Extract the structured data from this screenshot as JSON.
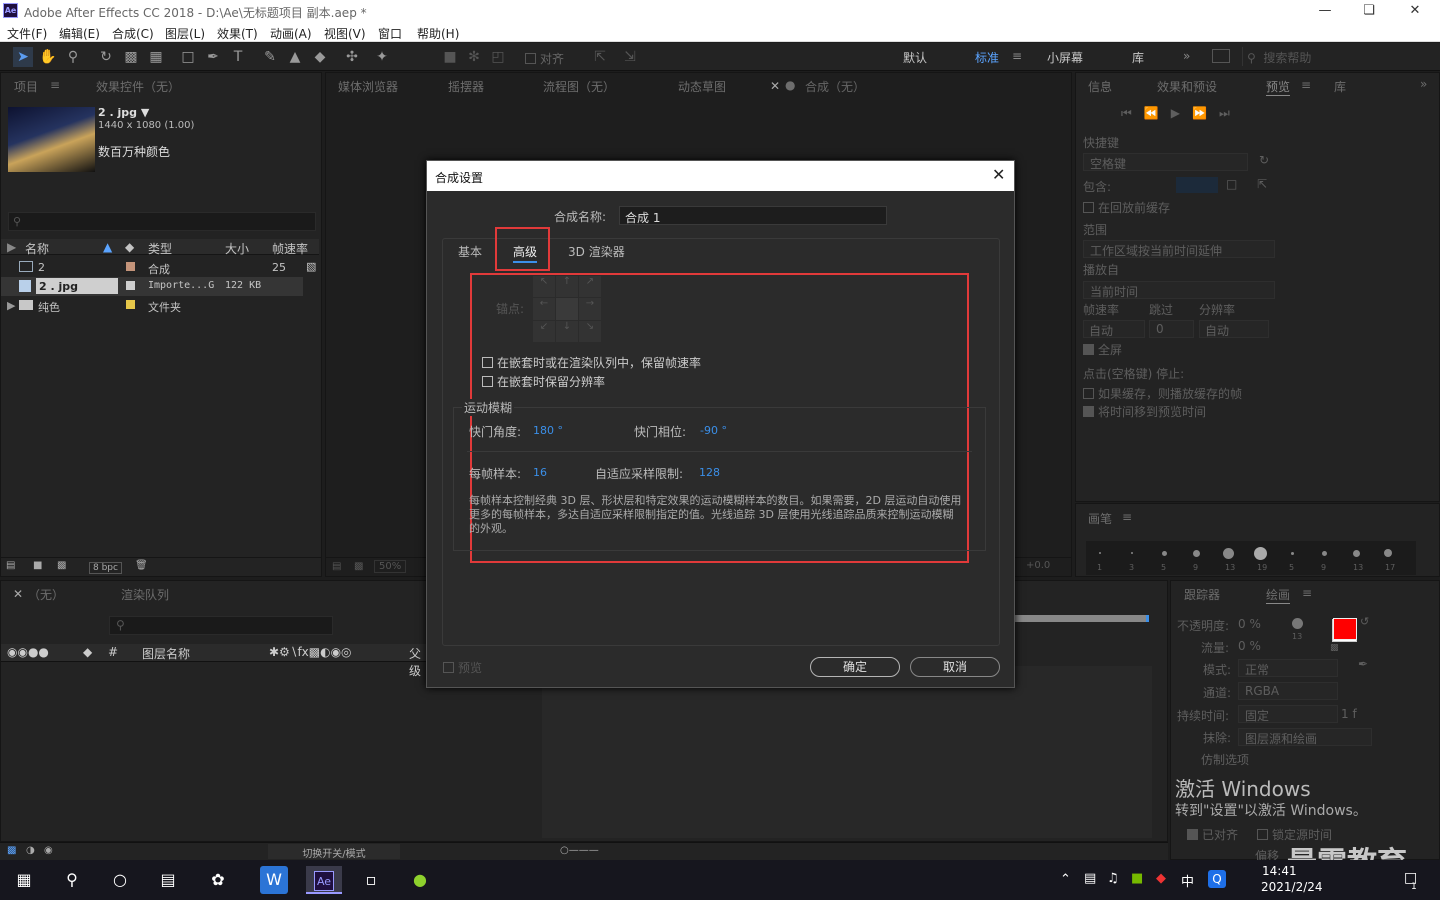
{
  "window": {
    "title": "Adobe After Effects CC 2018 - D:\\Ae\\无标题项目 副本.aep *",
    "logo": "Ae"
  },
  "menu": [
    "文件(F)",
    "编辑(E)",
    "合成(C)",
    "图层(L)",
    "效果(T)",
    "动画(A)",
    "视图(V)",
    "窗口",
    "帮助(H)"
  ],
  "toolbar": {
    "align_label": "对齐",
    "workspaces": [
      "默认",
      "标准",
      "小屏幕",
      "库"
    ],
    "active_workspace": "标准",
    "search_placeholder": "搜索帮助"
  },
  "project_panel": {
    "tabs": [
      "项目",
      "效果控件（无）"
    ],
    "asset": {
      "name": "2 . jpg",
      "dimensions": "1440 x 1080 (1.00)",
      "color": "数百万种颜色"
    },
    "columns": [
      "名称",
      "类型",
      "大小",
      "帧速率"
    ],
    "rows": [
      {
        "name": "2",
        "type": "合成",
        "size": "",
        "fps": "25",
        "label_color": "#c4947a"
      },
      {
        "name": "2 . jpg",
        "type": "Importe...G",
        "size": "122 KB",
        "fps": "",
        "label_color": "#cfcfcf"
      },
      {
        "name": "纯色",
        "type": "文件夹",
        "size": "",
        "fps": "",
        "label_color": "#e6c74a"
      }
    ],
    "bpc": "8 bpc"
  },
  "viewer_tabs": [
    "媒体浏览器",
    "摇摆器",
    "流程图（无）",
    "动态草图",
    "合成（无）"
  ],
  "viewer_zoom": "50%",
  "viewer_offset": "+0.0",
  "timeline": {
    "tabs": [
      "（无）",
      "渲染队列"
    ],
    "layer_col": "图层名称",
    "parent_col": "父级",
    "footer": "切换开关/模式"
  },
  "preview_panel": {
    "tabs": [
      "信息",
      "效果和预设",
      "预览",
      "库"
    ],
    "shortcut_label": "快捷键",
    "shortcut_value": "空格键",
    "include_label": "包含:",
    "cache_label": "在回放前缓存",
    "range_label": "范围",
    "range_value": "工作区域按当前时间延伸",
    "play_from_label": "播放自",
    "play_from_value": "当前时间",
    "fps_label": "帧速率",
    "skip_label": "跳过",
    "res_label": "分辨率",
    "fps_value": "自动",
    "skip_value": "0",
    "res_value": "自动",
    "fullscreen": "全屏",
    "stop_label": "点击(空格键) 停止:",
    "opt1": "如果缓存，则播放缓存的帧",
    "opt2": "将时间移到预览时间"
  },
  "brush_panel": {
    "title": "画笔",
    "sizes": [
      "1",
      "3",
      "5",
      "9",
      "13",
      "19",
      "5",
      "9",
      "13",
      "17"
    ]
  },
  "paint_panel": {
    "tabs": [
      "跟踪器",
      "绘画"
    ],
    "opacity_label": "不透明度:",
    "opacity": "0 %",
    "flow_label": "流量:",
    "flow": "0 %",
    "mode_label": "模式:",
    "mode": "正常",
    "channel_label": "通道:",
    "channel": "RGBA",
    "duration_label": "持续时间:",
    "duration": "固定",
    "erase_label": "抹除:",
    "erase": "图层源和绘画",
    "clone_label": "仿制选项",
    "aligned": "已对齐",
    "lock_time": "锁定源时间",
    "offset_label": "偏移",
    "fg_color": "#ff0000",
    "bg_color": "#ffffff",
    "brush_size": "13",
    "frames": "1 f"
  },
  "activation": {
    "title": "激活 Windows",
    "subtitle": "转到\"设置\"以激活 Windows。"
  },
  "watermark": "最需教育",
  "dialog": {
    "title": "合成设置",
    "name_label": "合成名称:",
    "name_value": "合成 1",
    "tabs": [
      "基本",
      "高级",
      "3D 渲染器"
    ],
    "active_tab": "高级",
    "anchor_label": "锚点:",
    "opt_preserve_fps": "在嵌套时或在渲染队列中，保留帧速率",
    "opt_preserve_res": "在嵌套时保留分辨率",
    "motion_blur_title": "运动模糊",
    "shutter_angle_label": "快门角度:",
    "shutter_angle": "180 °",
    "shutter_phase_label": "快门相位:",
    "shutter_phase": "-90 °",
    "samples_label": "每帧样本:",
    "samples": "16",
    "adaptive_label": "自适应采样限制:",
    "adaptive": "128",
    "description": "每帧样本控制经典 3D 层、形状层和特定效果的运动模糊样本的数目。如果需要，2D 层运动自动使用更多的每帧样本，多达自适应采样限制指定的值。光线追踪 3D 层使用光线追踪品质来控制运动模糊的外观。",
    "preview_label": "预览",
    "ok": "确定",
    "cancel": "取消"
  },
  "taskbar": {
    "time": "14:41",
    "date": "2021/2/24",
    "ime": "中",
    "notif": "1"
  }
}
